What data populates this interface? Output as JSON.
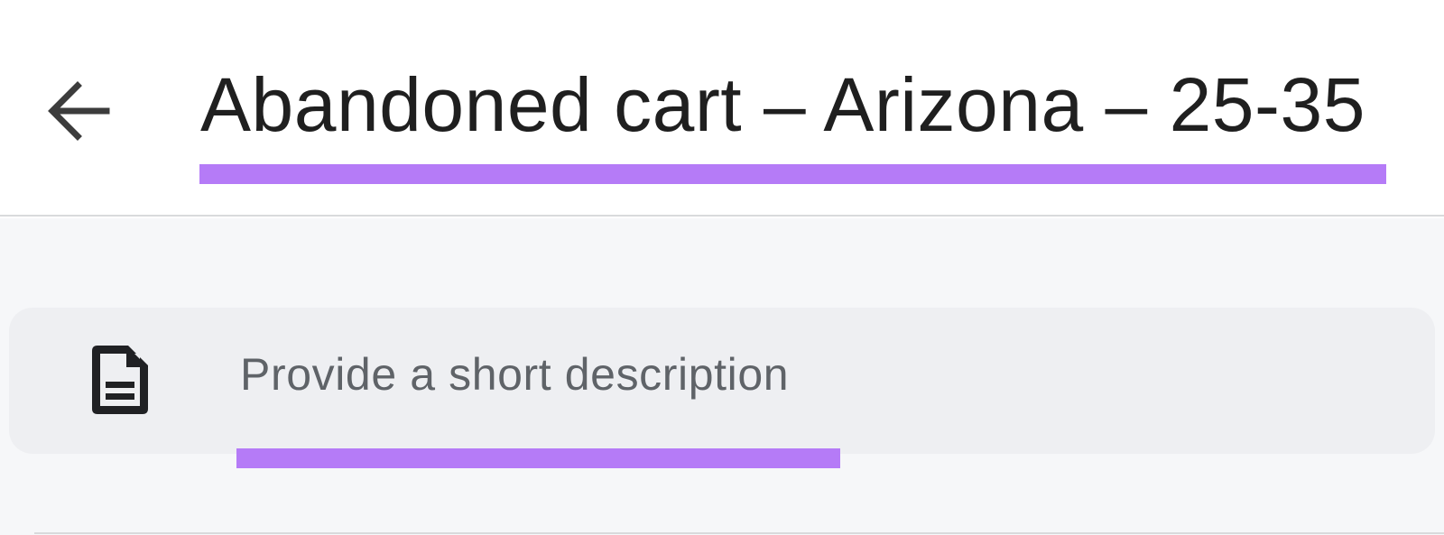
{
  "header": {
    "back_icon": "arrow-left-icon",
    "title": "Abandoned cart – Arizona – 25-35"
  },
  "description": {
    "icon": "document-icon",
    "placeholder": "Provide a short description",
    "value": ""
  },
  "colors": {
    "accent_underline": "#b57bf7",
    "title_text": "#1f1f1f",
    "placeholder_text": "#5f6368",
    "card_background": "#eeeff2",
    "content_background": "#f6f7f9"
  }
}
